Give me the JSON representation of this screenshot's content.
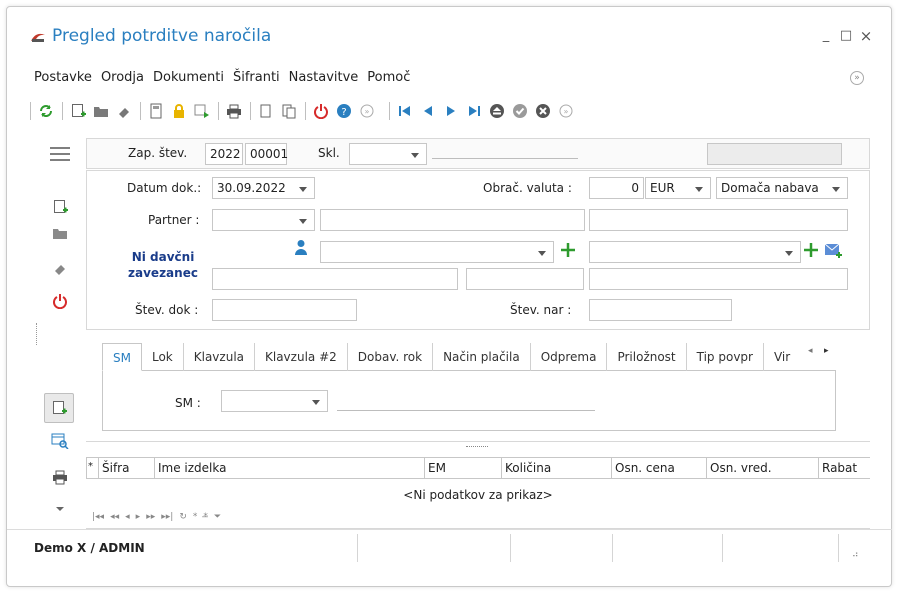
{
  "window": {
    "title": "Pregled potrditve naročila",
    "controls": {
      "minimize": "_",
      "maximize": "□",
      "close": "×"
    }
  },
  "menu": [
    "Postavke",
    "Orodja",
    "Dokumenti",
    "Šifranti",
    "Nastavitve",
    "Pomoč"
  ],
  "toolbar_icons": [
    "refresh-icon",
    "new-icon",
    "open-folder-icon",
    "eraser-icon",
    "calculator-icon",
    "lock-icon",
    "grid-export-icon",
    "print-icon",
    "copy-icon",
    "paste-icon",
    "power-icon",
    "help-icon",
    "circle-arrow-icon",
    "first-record-icon",
    "prev-record-icon",
    "next-record-icon",
    "last-record-icon",
    "eject-icon",
    "confirm-icon",
    "cancel-icon",
    "more-icon"
  ],
  "header": {
    "zap_label": "Zap. štev.",
    "zap_year": "2022",
    "zap_number": "00001",
    "skl_label": "Skl.",
    "skl_value": ""
  },
  "form": {
    "datum_label": "Datum dok.:",
    "datum_value": "30.09.2022",
    "partner_label": "Partner :",
    "davcni_text": "Ni davčni zavezanec",
    "stev_dok_label": "Štev. dok :",
    "obrac_label": "Obrač. valuta :",
    "obrac_value": "0",
    "currency": "EUR",
    "nabava": "Domača nabava",
    "stev_nar_label": "Štev. nar :"
  },
  "tabs": [
    "SM",
    "Lok",
    "Klavzula",
    "Klavzula #2",
    "Dobav. rok",
    "Način plačila",
    "Odprema",
    "Priložnost",
    "Tip povpr",
    "Vir"
  ],
  "tab_content": {
    "sm_label": "SM :",
    "sm_value": ""
  },
  "grid": {
    "columns": [
      "Šifra",
      "Ime izdelka",
      "EM",
      "Količina",
      "Osn. cena",
      "Osn. vred.",
      "Rabat"
    ],
    "empty_text": "<Ni podatkov za prikaz>",
    "nav_icons": [
      "first-icon",
      "prev-page-icon",
      "prev-icon",
      "next-icon",
      "next-page-icon",
      "last-icon",
      "refresh-icon",
      "add-icon",
      "insert-icon",
      "filter-icon"
    ]
  },
  "status_bar": {
    "user": "Demo X / ADMIN"
  },
  "colors": {
    "accent": "#2a7fc0",
    "green": "#2e9b2e",
    "red": "#d62b2b",
    "navy": "#1a3c8a"
  }
}
